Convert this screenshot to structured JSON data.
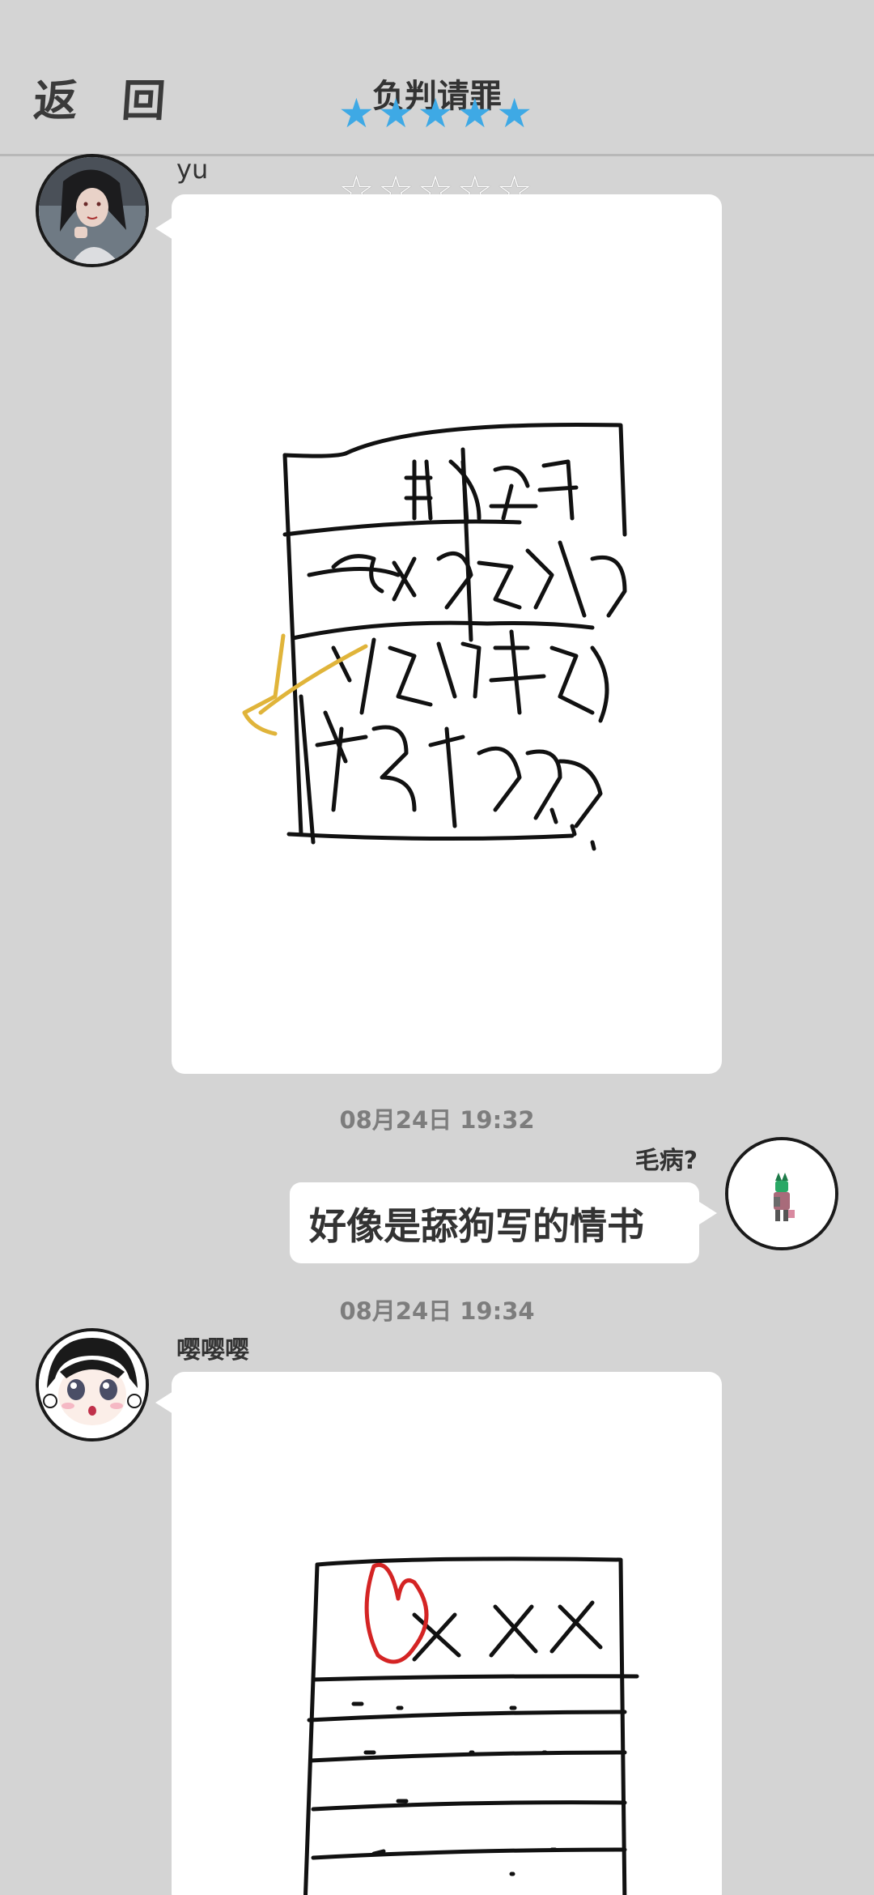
{
  "header": {
    "back_label": "返 回",
    "title": "负判请罪",
    "stars_icon": "star-icon"
  },
  "rating": {
    "rated_stars": "★★★★★",
    "rated_count": 5,
    "empty_stars": "☆☆☆☆☆",
    "empty_count": 5,
    "rated_color": "#3ea9e5"
  },
  "messages": [
    {
      "sender": "yu",
      "side": "left",
      "type": "drawing",
      "drawing_icon": "handwritten-note-drawing"
    },
    {
      "timestamp": "08月24日  19:32"
    },
    {
      "sender": "毛病?",
      "side": "right",
      "type": "text",
      "text": "好像是舔狗写的情书"
    },
    {
      "timestamp": "08月24日  19:34"
    },
    {
      "sender": "嘤嘤嘤",
      "side": "left",
      "type": "drawing",
      "drawing_icon": "love-letter-drawing"
    }
  ],
  "colors": {
    "background": "#d4d4d4",
    "card": "#ffffff",
    "ink": "#111111",
    "highlight_yellow": "#e0b43a",
    "heart_red": "#d42424"
  }
}
